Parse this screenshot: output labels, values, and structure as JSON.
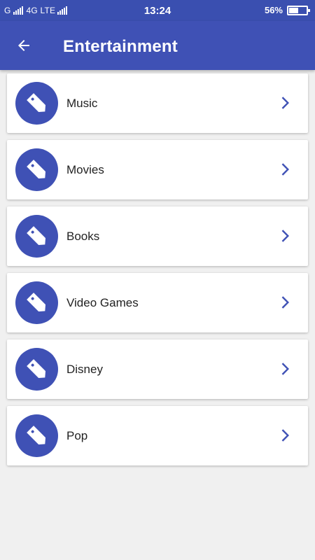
{
  "status": {
    "carrier1": "G",
    "carrier2": "4G LTE",
    "time": "13:24",
    "battery": "56%",
    "battery_level": 0.56
  },
  "app_bar": {
    "title": "Entertainment",
    "back_icon": "arrow-left-icon"
  },
  "colors": {
    "primary": "#3f51b5",
    "status_bar": "#3a4fb0",
    "background": "#f0f0f0"
  },
  "categories": [
    {
      "label": "Music",
      "icon": "tag-icon"
    },
    {
      "label": "Movies",
      "icon": "tag-icon"
    },
    {
      "label": "Books",
      "icon": "tag-icon"
    },
    {
      "label": "Video Games",
      "icon": "tag-icon"
    },
    {
      "label": "Disney",
      "icon": "tag-icon"
    },
    {
      "label": "Pop",
      "icon": "tag-icon"
    }
  ]
}
